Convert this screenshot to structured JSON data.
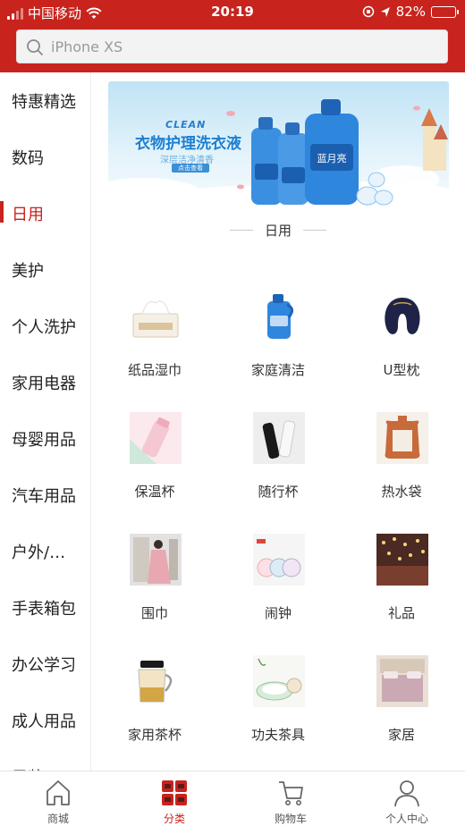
{
  "status_bar": {
    "carrier": "中国移动",
    "time": "20:19",
    "battery": "82%",
    "battery_level": 0.82
  },
  "search": {
    "placeholder": "iPhone XS"
  },
  "sidebar": {
    "items": [
      {
        "label": "特惠精选"
      },
      {
        "label": "数码"
      },
      {
        "label": "日用",
        "active": true
      },
      {
        "label": "美护"
      },
      {
        "label": "个人洗护"
      },
      {
        "label": "家用电器"
      },
      {
        "label": "母婴用品"
      },
      {
        "label": "汽车用品"
      },
      {
        "label": "户外/…"
      },
      {
        "label": "手表箱包"
      },
      {
        "label": "办公学习"
      },
      {
        "label": "成人用品"
      },
      {
        "label": "男装"
      }
    ]
  },
  "banner": {
    "brand_word": "CLEAN",
    "headline": "衣物护理洗衣液",
    "subline": "深层洁净清香",
    "button": "点击查看",
    "product_text": "蓝月亮"
  },
  "section": {
    "title": "日用"
  },
  "products": [
    {
      "label": "纸品湿巾",
      "icon": "tissue-box-icon"
    },
    {
      "label": "家庭清洁",
      "icon": "detergent-bottle-icon"
    },
    {
      "label": "U型枕",
      "icon": "neck-pillow-icon"
    },
    {
      "label": "保温杯",
      "icon": "thermos-icon"
    },
    {
      "label": "随行杯",
      "icon": "travel-cup-icon"
    },
    {
      "label": "热水袋",
      "icon": "hot-water-bag-icon"
    },
    {
      "label": "围巾",
      "icon": "scarf-icon"
    },
    {
      "label": "闹钟",
      "icon": "alarm-clock-icon"
    },
    {
      "label": "礼品",
      "icon": "gift-lights-icon"
    },
    {
      "label": "家用茶杯",
      "icon": "tea-cup-icon"
    },
    {
      "label": "功夫茶具",
      "icon": "tea-set-icon"
    },
    {
      "label": "家居",
      "icon": "bedding-icon"
    }
  ],
  "tabbar": {
    "items": [
      {
        "label": "商城",
        "icon": "home-icon"
      },
      {
        "label": "分类",
        "icon": "category-icon",
        "active": true
      },
      {
        "label": "购物车",
        "icon": "cart-icon"
      },
      {
        "label": "个人中心",
        "icon": "user-icon"
      }
    ]
  },
  "colors": {
    "brand_red": "#c8231d",
    "battery_green": "#4cd964"
  }
}
